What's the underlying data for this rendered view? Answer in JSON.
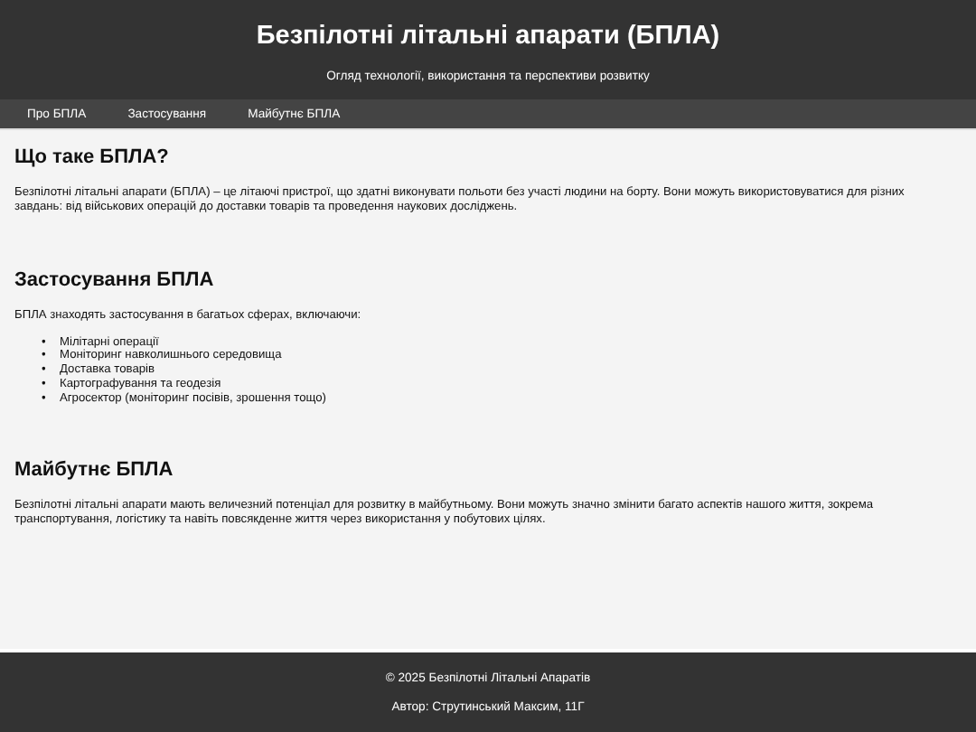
{
  "header": {
    "title": "Безпілотні літальні апарати (БПЛА)",
    "subtitle": "Огляд технології, використання та перспективи розвитку"
  },
  "nav": [
    {
      "label": "Про БПЛА"
    },
    {
      "label": "Застосування"
    },
    {
      "label": "Майбутнє БПЛА"
    }
  ],
  "sections": [
    {
      "heading": "Що таке БПЛА?",
      "paragraph": "Безпілотні літальні апарати (БПЛА) – це літаючі пристрої, що здатні виконувати польоти без участі людини на борту. Вони можуть використовуватися для різних завдань: від військових операцій до доставки товарів та проведення наукових досліджень."
    },
    {
      "heading": "Застосування БПЛА",
      "paragraph": "БПЛА знаходять застосування в багатьох сферах, включаючи:",
      "list": [
        {
          "marker": "•",
          "text": "Мілітарні операції"
        },
        {
          "marker": "•",
          "text": "Моніторинг навколишнього середовища"
        },
        {
          "marker": "•",
          "text": "Доставка товарів"
        },
        {
          "marker": "•",
          "text": "Картографування та геодезія"
        },
        {
          "marker": "•",
          "text": "Агросектор (моніторинг посівів, зрошення тощо)"
        }
      ]
    },
    {
      "heading": "Майбутнє БПЛА",
      "paragraph": "Безпілотні літальні апарати мають величезний потенціал для розвитку в майбутньому. Вони можуть значно змінити багато аспектів нашого життя, зокрема транспортування, логістику та навіть повсякденне життя через використання у побутових цілях."
    }
  ],
  "footer": {
    "copyright": "© 2025 Безпілотні Літальні Апаратів",
    "author": "Автор: Струтинський Максим, 11Г"
  }
}
